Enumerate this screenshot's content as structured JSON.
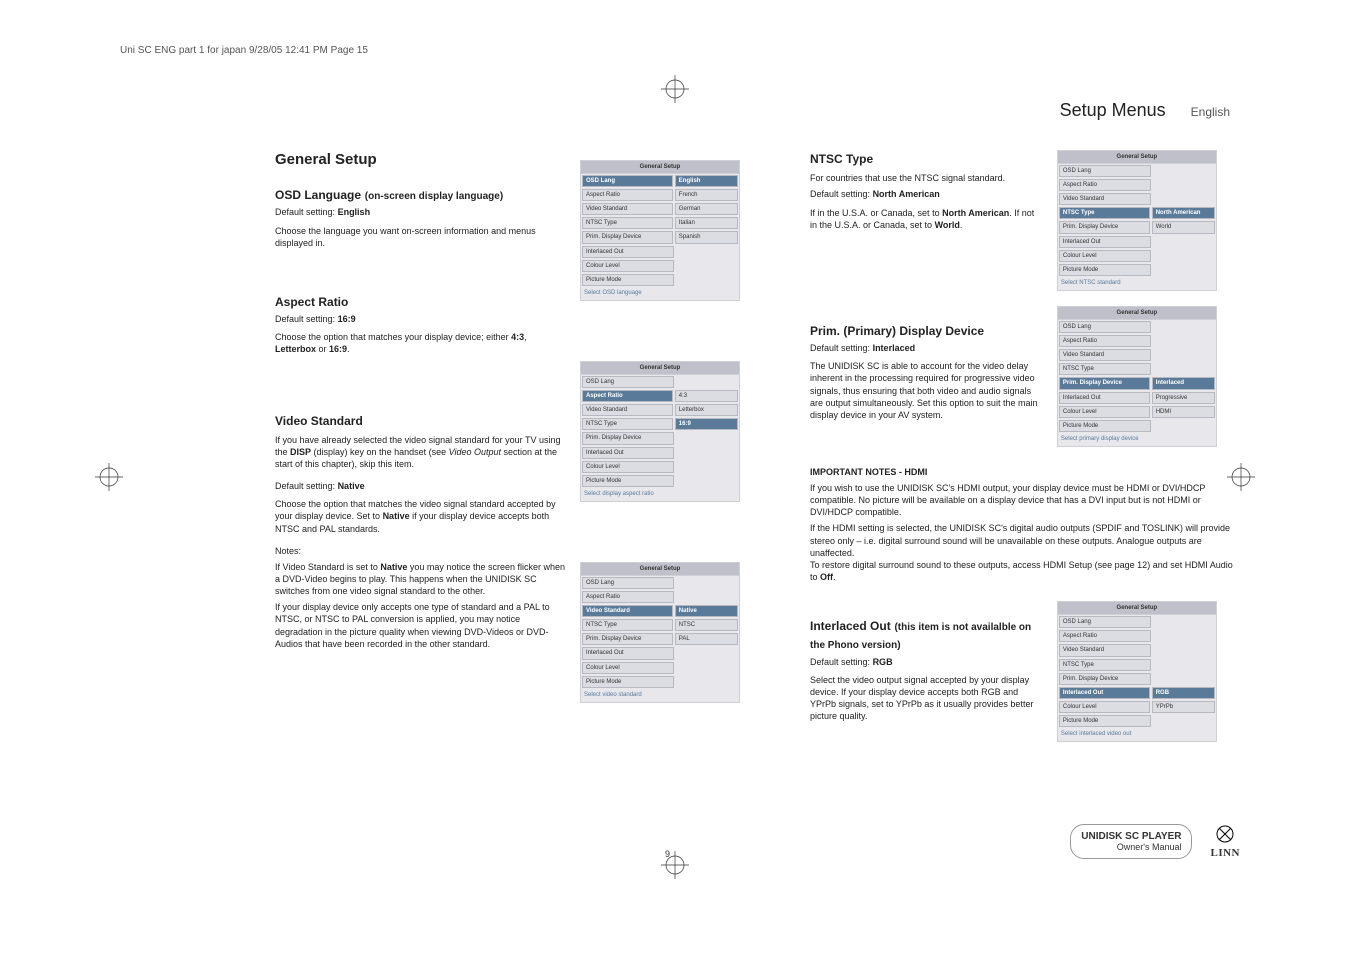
{
  "print_info": "Uni SC ENG part 1 for japan  9/28/05  12:41 PM  Page 15",
  "header": {
    "title": "Setup Menus",
    "lang": "English"
  },
  "left": {
    "h1": "General Setup",
    "osd": {
      "head_main": "OSD Language",
      "head_sub": "(on-screen display language)",
      "default_label": "Default setting:",
      "default_value": "English",
      "body": "Choose the language you want on-screen information and menus displayed in."
    },
    "aspect": {
      "head_main": "Aspect Ratio",
      "default_label": "Default setting:",
      "default_value": "16:9",
      "body_a": "Choose the option that matches your display device; either ",
      "body_b": "4:3",
      "body_c": ", ",
      "body_d": "Letterbox",
      "body_e": " or ",
      "body_f": "16:9",
      "body_g": "."
    },
    "video": {
      "head_main": "Video Standard",
      "p1_a": "If you have already selected the video signal standard for your TV using the ",
      "p1_b": "DISP",
      "p1_c": " (display) key on the handset (see ",
      "p1_d": "Video Output",
      "p1_e": " section at the start of this chapter), skip this item.",
      "default_label": "Default setting:",
      "default_value": "Native",
      "p2_a": "Choose the option that matches the video signal standard accepted by your display device. Set to ",
      "p2_b": "Native",
      "p2_c": " if your display device accepts both NTSC and PAL standards.",
      "notes_head": "Notes:",
      "n1_a": "If Video Standard is set to ",
      "n1_b": "Native",
      "n1_c": " you may notice the screen flicker when a DVD-Video begins to play. This happens when the UNIDISK SC switches from one video signal standard to the other.",
      "n2": "If your display device only accepts one type of standard and a PAL to NTSC, or NTSC to PAL conversion is applied, you may notice degradation in the picture quality when viewing DVD-Videos or DVD-Audios that have been recorded in the other standard."
    }
  },
  "right": {
    "ntsc": {
      "head_main": "NTSC Type",
      "p1": "For countries that use the NTSC signal standard.",
      "default_label": "Default setting:",
      "default_value": "North American",
      "p2_a": "If in the U.S.A. or Canada, set to ",
      "p2_b": "North American",
      "p2_c": ". If not in the U.S.A. or Canada, set to ",
      "p2_d": "World",
      "p2_e": "."
    },
    "prim": {
      "head_main": "Prim. (Primary) Display Device",
      "default_label": "Default setting:",
      "default_value": "Interlaced",
      "p1": "The UNIDISK SC is able to account for the video delay inherent in the processing required for progressive video signals, thus ensuring that both video and audio signals are output simultaneously. Set this option to suit the main display device in your AV system."
    },
    "hdmi": {
      "head": "IMPORTANT NOTES - HDMI",
      "p1": "If you wish to use the UNIDISK SC's HDMI output, your display device must be HDMI or DVI/HDCP compatible. No picture will be available on a display device that has a DVI input but is not HDMI or DVI/HDCP compatible.",
      "p2_a": "If the HDMI setting is selected, the UNIDISK SC's digital audio outputs (SPDIF and TOSLINK) will provide stereo only – i.e. digital surround sound will be unavailable on these outputs. Analogue outputs are unaffected.",
      "p2_b": "To restore digital surround sound to these outputs, access HDMI Setup (see page 12) and set HDMI Audio to ",
      "p2_c": "Off",
      "p2_d": "."
    },
    "inter": {
      "head_main": "Interlaced Out",
      "head_sub": "(this item is not availalble on the Phono version)",
      "default_label": "Default setting:",
      "default_value": "RGB",
      "p1": "Select the video output signal accepted by your display device. If your display device accepts both RGB and YPrPb signals, set to YPrPb as it usually provides better picture quality."
    }
  },
  "menus": {
    "title": "General Setup",
    "items": [
      "OSD Lang",
      "Aspect Ratio",
      "Video Standard",
      "NTSC Type",
      "Prim. Display Device",
      "Interlaced Out",
      "Colour Level",
      "Picture Mode"
    ],
    "osd": {
      "sel_idx": 0,
      "opts": [
        "English",
        "French",
        "German",
        "Italian",
        "Spanish"
      ],
      "opt_sel": 0,
      "hint": "Select OSD language"
    },
    "aspect": {
      "sel_idx": 1,
      "opts": [
        "4:3",
        "Letterbox",
        "16:9"
      ],
      "opt_sel": 2,
      "hint": "Select display aspect ratio"
    },
    "video": {
      "sel_idx": 2,
      "opts": [
        "Native",
        "NTSC",
        "PAL"
      ],
      "opt_sel": 0,
      "hint": "Select video standard"
    },
    "ntsc": {
      "sel_idx": 3,
      "opts": [
        "North American",
        "World"
      ],
      "opt_sel": 0,
      "hint": "Select NTSC standard"
    },
    "prim": {
      "sel_idx": 4,
      "opts": [
        "Interlaced",
        "Progressive",
        "HDMI"
      ],
      "opt_sel": 0,
      "hint": "Select primary display device"
    },
    "inter": {
      "sel_idx": 5,
      "opts": [
        "RGB",
        "YPrPb"
      ],
      "opt_sel": 0,
      "hint": "Select interlaced video out"
    }
  },
  "footer": {
    "page_no": "9",
    "product_name": "UNIDISK SC PLAYER",
    "product_sub": "Owner's Manual",
    "logo_text": "LINN"
  }
}
